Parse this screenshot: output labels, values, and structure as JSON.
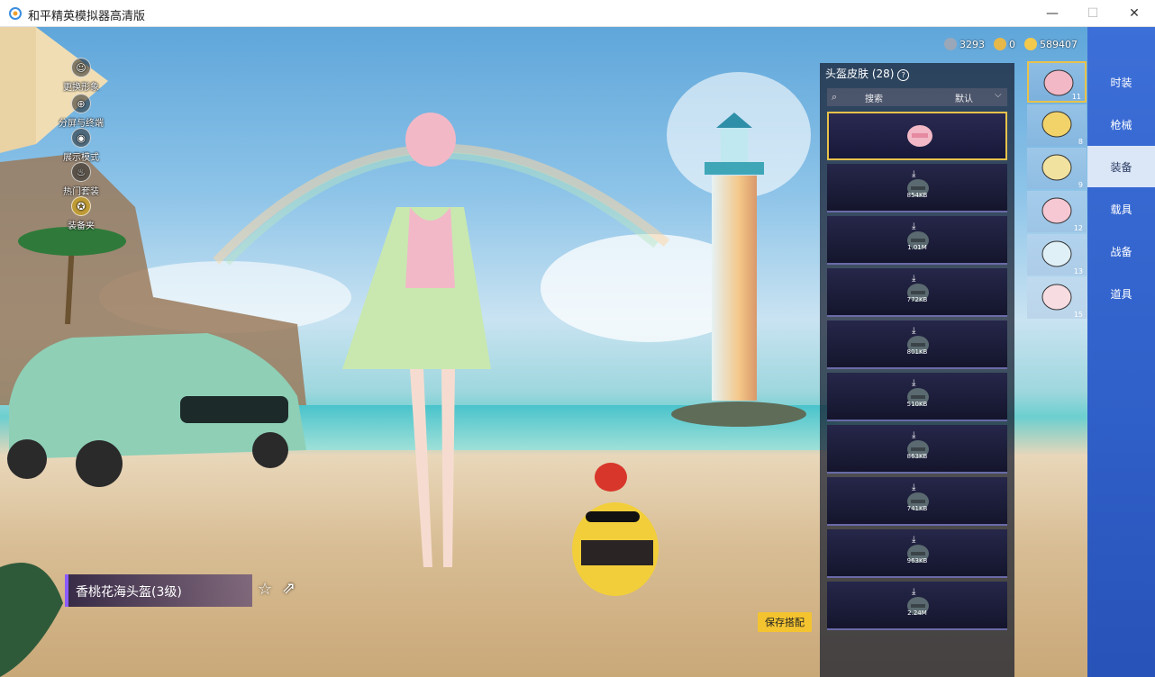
{
  "window": {
    "title": "和平精英模拟器高清版",
    "minimize": "—",
    "maximize": "☐",
    "close": "✕"
  },
  "currencies": [
    {
      "value": "3293",
      "icon": "coupon-icon",
      "color": "#9aa7b8"
    },
    {
      "value": "0",
      "icon": "token-icon",
      "color": "#e6b84a"
    },
    {
      "value": "589407",
      "icon": "gold-coin-icon",
      "color": "#f2c94c"
    }
  ],
  "left_menu": [
    {
      "label": "更换形象",
      "icon": "person-icon",
      "glyph": "☺"
    },
    {
      "label": "分屏与终端",
      "icon": "split-icon",
      "glyph": "⊕"
    },
    {
      "label": "展示模式",
      "icon": "eye-icon",
      "glyph": "◉"
    },
    {
      "label": "热门套装",
      "icon": "fire-icon",
      "glyph": "♨"
    },
    {
      "label": "装备夹",
      "icon": "badge-icon",
      "glyph": "✪"
    }
  ],
  "item_name": "香桃花海头盔(3级)",
  "save_label": "保存搭配",
  "list": {
    "title": "头盔皮肤 (28)",
    "help": "?",
    "search_label": "搜索",
    "sort_label": "默认",
    "slots": [
      {
        "size": "",
        "selected": true
      },
      {
        "size": "854KB"
      },
      {
        "size": "1.01M"
      },
      {
        "size": "772KB"
      },
      {
        "size": "801KB"
      },
      {
        "size": "510KB"
      },
      {
        "size": "863KB"
      },
      {
        "size": "741KB"
      },
      {
        "size": "963KB"
      },
      {
        "size": "2.24M"
      }
    ]
  },
  "thumbnails": [
    {
      "count": "11",
      "selected": true
    },
    {
      "count": "8"
    },
    {
      "count": "9"
    },
    {
      "count": "12"
    },
    {
      "count": "13"
    },
    {
      "count": "15"
    }
  ],
  "categories": [
    {
      "label": "时装"
    },
    {
      "label": "枪械"
    },
    {
      "label": "装备",
      "active": true
    },
    {
      "label": "载具"
    },
    {
      "label": "战备"
    },
    {
      "label": "道具"
    }
  ]
}
